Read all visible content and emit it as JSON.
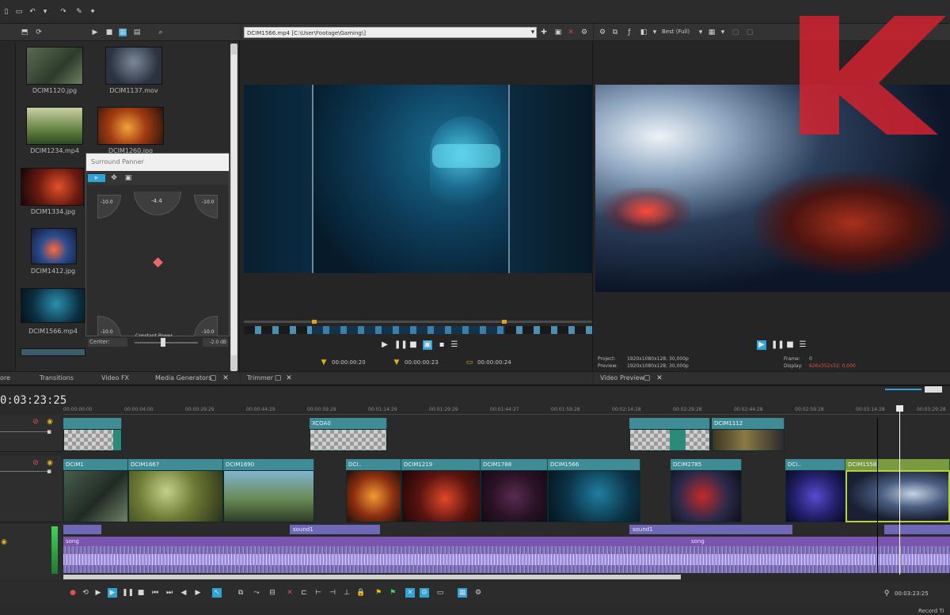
{
  "explorer": {
    "items": [
      "DCIM1120.jpg",
      "DCIM1137.mov",
      "DCIM1234.mp4",
      "DCIM1260.jpg",
      "DCIM1334.jpg",
      "",
      "DCIM1412.jpg",
      "",
      "DCIM1566.mp4",
      ""
    ],
    "tabs": [
      "ore",
      "Transitions",
      "Video FX",
      "Media Generators"
    ]
  },
  "surround": {
    "title": "Surround Panner",
    "fl": "-10.0",
    "c": "-4.4",
    "fr": "-10.0",
    "rl": "-10.0",
    "rr": "-10.0",
    "center": "Constant Power",
    "fader_label": "Center:",
    "fader_val": "-2.0 dB"
  },
  "trimmer": {
    "file": "DCIM1566.mp4   [C:\\User\\Footage\\Gaming\\]",
    "tab": "Trimmer",
    "tc_in": "00:00:00:20",
    "tc_mid": "00:00:00:23",
    "tc_len": "00:00:00:24"
  },
  "preview": {
    "quality": "Best (Full)",
    "project_label": "Project:",
    "project_val": "1920x1080x128; 30,000p",
    "preview_label": "Preview:",
    "preview_val": "1920x1080x128; 30,000p",
    "frame_label": "Frame:",
    "frame_val": "0",
    "display_label": "Display:",
    "display_val": "626x352x32; 0,000",
    "tab": "Video Preview"
  },
  "timeline": {
    "timecode": "0:03:23:25",
    "ruler": [
      "00:00:00:00",
      "00:00:04:00",
      "00:00:29:29",
      "00:00:44:29",
      "00:00:59:29",
      "00:01:14:29",
      "00:01:29:29",
      "00:01:44:27",
      "00:01:59:28",
      "00:02:14:28",
      "00:02:29:28",
      "00:02:44:28",
      "00:02:59:28",
      "00:03:14:28",
      "00:03:29:28"
    ],
    "overlay_clips": [
      "",
      "DCIM1",
      "XCOA0",
      "",
      "",
      "",
      "DCIM1112"
    ],
    "video_clips": [
      "DCIM1",
      "DCIM1667",
      "DCIM1690",
      "DCI..",
      "DCIM1219",
      "DCIM1788",
      "DCIM1566",
      "DCIM2785",
      "DCI..",
      "DCIM1558"
    ],
    "audio_sound": [
      "sound1",
      "sound1"
    ],
    "song": "song",
    "status_time": "00:03:23:25",
    "record_time": "Record Ti"
  },
  "colors": {
    "accent": "#2ea3d6",
    "clip": "#3f8c96",
    "audio": "#6f68b8",
    "logo": "#d2222e"
  }
}
